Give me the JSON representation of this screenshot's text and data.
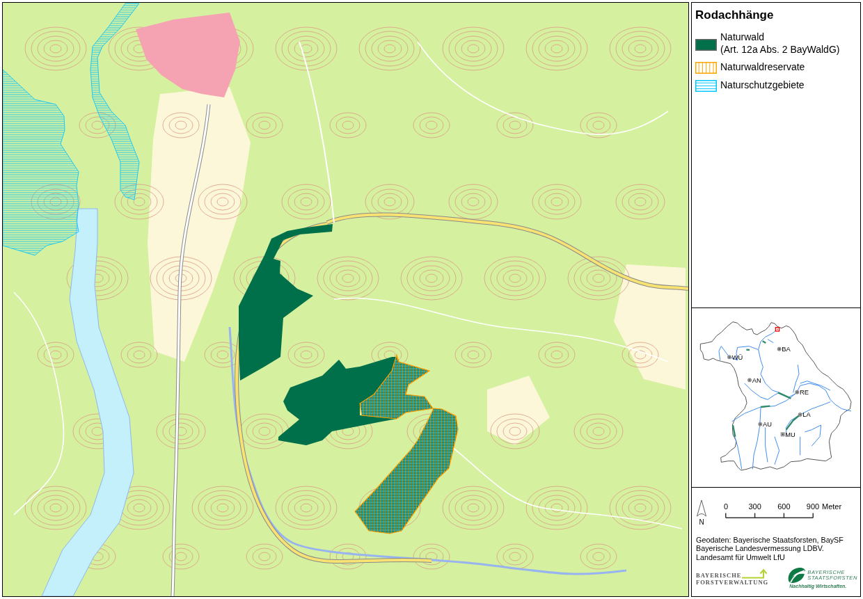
{
  "legend": {
    "title": "Rodachhänge",
    "items": [
      {
        "kind": "naturwald",
        "lines": [
          "Naturwald",
          "(Art. 12a Abs. 2 BayWaldG)"
        ]
      },
      {
        "kind": "naturwaldreservat",
        "lines": [
          "Naturwaldreservate"
        ]
      },
      {
        "kind": "naturschutzgebiet",
        "lines": [
          "Naturschutzgebiete"
        ]
      }
    ]
  },
  "overview_map": {
    "cities": [
      {
        "label": "BA",
        "kind": "city"
      },
      {
        "label": "WÜ",
        "kind": "city"
      },
      {
        "label": "AN",
        "kind": "city"
      },
      {
        "label": "RE",
        "kind": "city"
      },
      {
        "label": "LA",
        "kind": "city"
      },
      {
        "label": "AU",
        "kind": "city"
      },
      {
        "label": "MU",
        "kind": "capital"
      }
    ]
  },
  "north_arrow": {
    "label": "N"
  },
  "scale_bar": {
    "ticks": [
      "0",
      "300",
      "600",
      "900"
    ],
    "unit": "Meter"
  },
  "credits": [
    "Geodaten: Bayerische Staatsforsten, BaySF",
    "Bayerische Landesvermessung LDBV.",
    "Landesamt für Umwelt LfU"
  ],
  "logos": [
    {
      "kind": "forstverwaltung",
      "lines": [
        "BAYERISCHE",
        "FORSTVERWALTUNG"
      ]
    },
    {
      "kind": "staatsforsten",
      "lines": [
        "BAYERISCHE",
        "STAATSFORSTEN"
      ],
      "tagline": "Nachhaltig Wirtschaften."
    }
  ]
}
